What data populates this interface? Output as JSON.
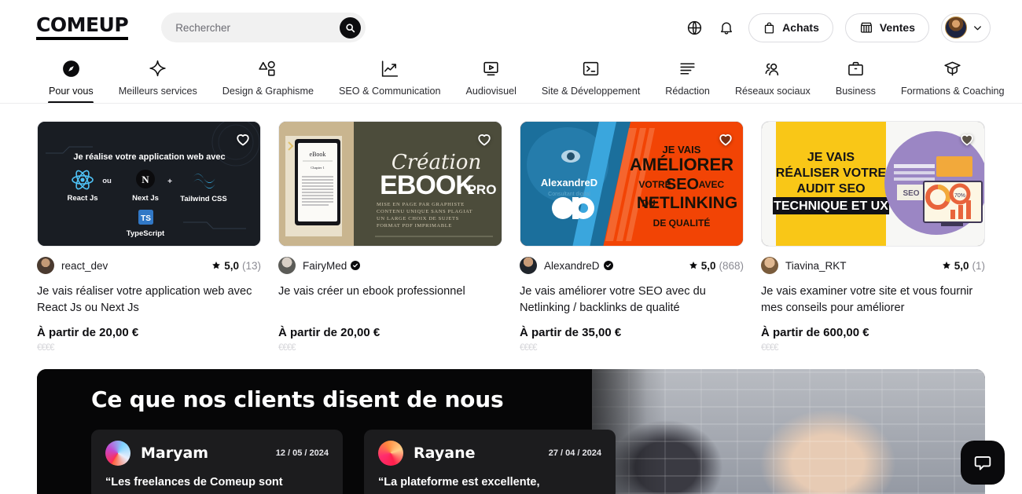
{
  "header": {
    "logo": "COMEUP",
    "search": {
      "value": "",
      "placeholder": "Rechercher"
    },
    "search_icon": "search-icon",
    "language_icon": "globe-icon",
    "notifications_icon": "bell-icon",
    "purchases_label": "Achats",
    "purchases_icon": "shopping-bag-icon",
    "sales_label": "Ventes",
    "sales_icon": "storefront-icon",
    "account_chevron_icon": "chevron-down-icon"
  },
  "nav": {
    "next_icon": "chevron-right-icon",
    "items": [
      {
        "label": "Pour vous",
        "icon": "compass-icon",
        "active": true
      },
      {
        "label": "Meilleurs services",
        "icon": "sparkle-icon",
        "active": false
      },
      {
        "label": "Design & Graphisme",
        "icon": "shapes-icon",
        "active": false
      },
      {
        "label": "SEO & Communication",
        "icon": "trend-up-icon",
        "active": false
      },
      {
        "label": "Audiovisuel",
        "icon": "video-play-icon",
        "active": false
      },
      {
        "label": "Site & Développement",
        "icon": "terminal-icon",
        "active": false
      },
      {
        "label": "Rédaction",
        "icon": "text-lines-icon",
        "active": false
      },
      {
        "label": "Réseaux sociaux",
        "icon": "people-icon",
        "active": false
      },
      {
        "label": "Business",
        "icon": "briefcase-icon",
        "active": false
      },
      {
        "label": "Formations & Coaching",
        "icon": "graduation-cap-icon",
        "active": false
      }
    ]
  },
  "cards": [
    {
      "seller": "react_dev",
      "verified": false,
      "rating": "5,0",
      "rating_count": "(13)",
      "title": "Je vais réaliser votre application web avec React Js ou Next Js",
      "price": "À partir de 20,00 €",
      "price_range": "€€€€",
      "favorited": false,
      "thumb": {
        "style": "dark-tech",
        "headline": "Je réalise votre application web avec",
        "tech": [
          "React Js",
          "Next Js",
          "Tailwind CSS",
          "TypeScript"
        ],
        "connectors": [
          "ou",
          "+"
        ]
      }
    },
    {
      "seller": "FairyMed",
      "verified": true,
      "rating": "",
      "rating_count": "",
      "title": "Je vais créer un ebook professionnel",
      "price": "À partir de 20,00 €",
      "price_range": "€€€€",
      "favorited": false,
      "thumb": {
        "style": "olive-ebook",
        "script": "Création",
        "headline": "EBOOK",
        "headline_small": "PRO",
        "bullets": [
          "MISE EN PAGE PAR GRAPHISTE",
          "CONTENU UNIQUE SANS PLAGIAT",
          "UN LARGE CHOIX DE SUJETS",
          "FORMAT PDF IMPRIMABLE"
        ],
        "device_label": "eBook"
      }
    },
    {
      "seller": "AlexandreD",
      "verified": true,
      "rating": "5,0",
      "rating_count": "(868)",
      "title": "Je vais améliorer votre SEO avec du Netlinking / backlinks de qualité",
      "price": "À partir de 35,00 €",
      "price_range": "€€€€",
      "favorited": true,
      "thumb": {
        "style": "orange-seo",
        "name": "AlexandreD",
        "lines": [
          "JE VAIS",
          "AMÉLIORER",
          "VOTRE SEO AVEC",
          "DU NETLINKING",
          "DE QUALITÉ"
        ]
      }
    },
    {
      "seller": "Tiavina_RKT",
      "verified": false,
      "rating": "5,0",
      "rating_count": "(1)",
      "title": "Je vais examiner votre site et vous fournir mes conseils pour améliorer",
      "price": "À partir de 600,00 €",
      "price_range": "€€€€",
      "favorited": true,
      "thumb": {
        "style": "yellow-audit",
        "lines": [
          "JE VAIS",
          "RÉALISER VOTRE",
          "AUDIT SEO"
        ],
        "highlight": "TECHNIQUE ET UX",
        "badge": "SEO"
      }
    }
  ],
  "banner": {
    "title": "Ce que nos clients disent de nous",
    "testimonials": [
      {
        "name": "Maryam",
        "date": "12 / 05 / 2024",
        "quote": "“Les freelances de Comeup sont"
      },
      {
        "name": "Rayane",
        "date": "27 / 04 / 2024",
        "quote": "“La plateforme est excellente,"
      }
    ]
  },
  "chat": {
    "icon": "chat-bubble-icon"
  }
}
